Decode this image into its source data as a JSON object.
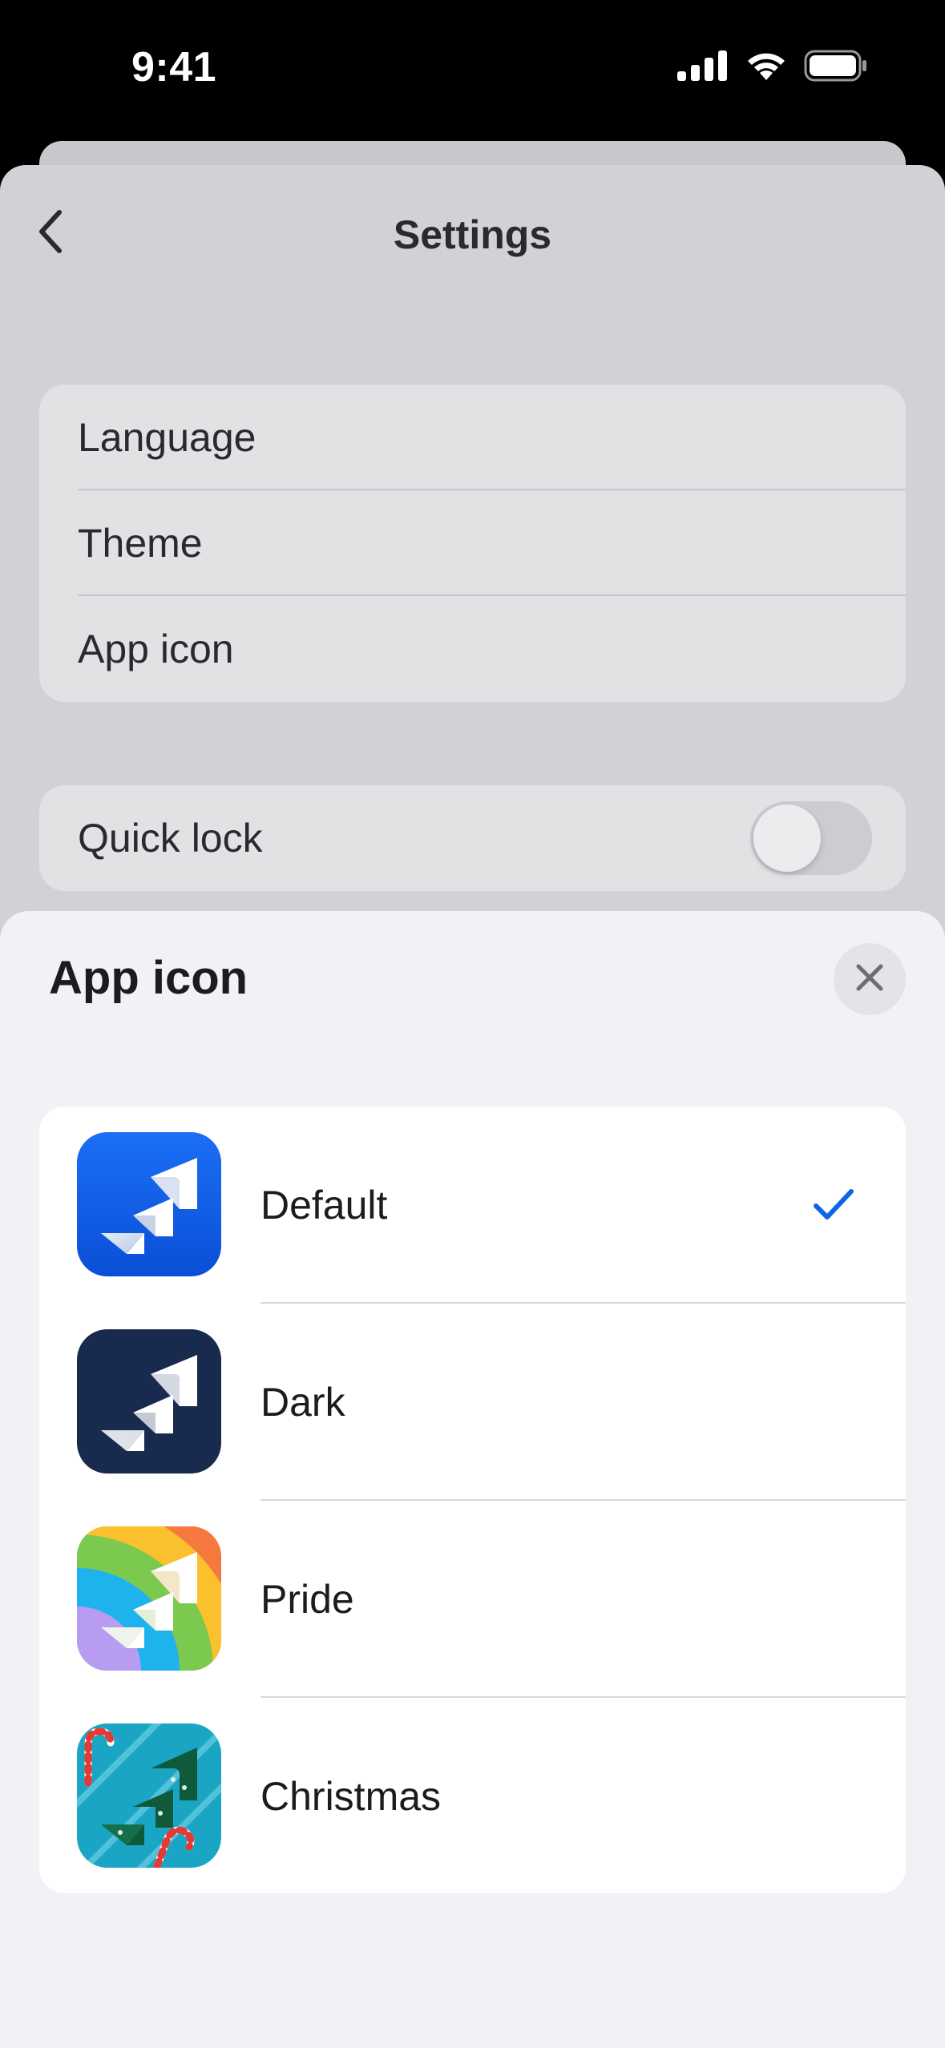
{
  "status_bar": {
    "time": "9:41"
  },
  "icons": {
    "back": "chevron-left-icon",
    "close": "close-x-icon",
    "check": "checkmark-icon",
    "signal": "cellular-signal-icon",
    "wifi": "wifi-icon",
    "battery": "battery-icon"
  },
  "settings": {
    "title": "Settings",
    "group1": [
      {
        "label": "Language"
      },
      {
        "label": "Theme"
      },
      {
        "label": "App icon"
      }
    ],
    "quick_lock": {
      "label": "Quick lock",
      "enabled": false
    }
  },
  "modal": {
    "title": "App icon",
    "options": [
      {
        "label": "Default",
        "selected": true,
        "style": "default"
      },
      {
        "label": "Dark",
        "selected": false,
        "style": "dark"
      },
      {
        "label": "Pride",
        "selected": false,
        "style": "pride"
      },
      {
        "label": "Christmas",
        "selected": false,
        "style": "christmas"
      }
    ]
  },
  "colors": {
    "accent": "#0c66e4",
    "default_icon": "#0c5fe8",
    "dark_icon": "#182a4e",
    "christmas_icon": "#1aa5c4"
  }
}
